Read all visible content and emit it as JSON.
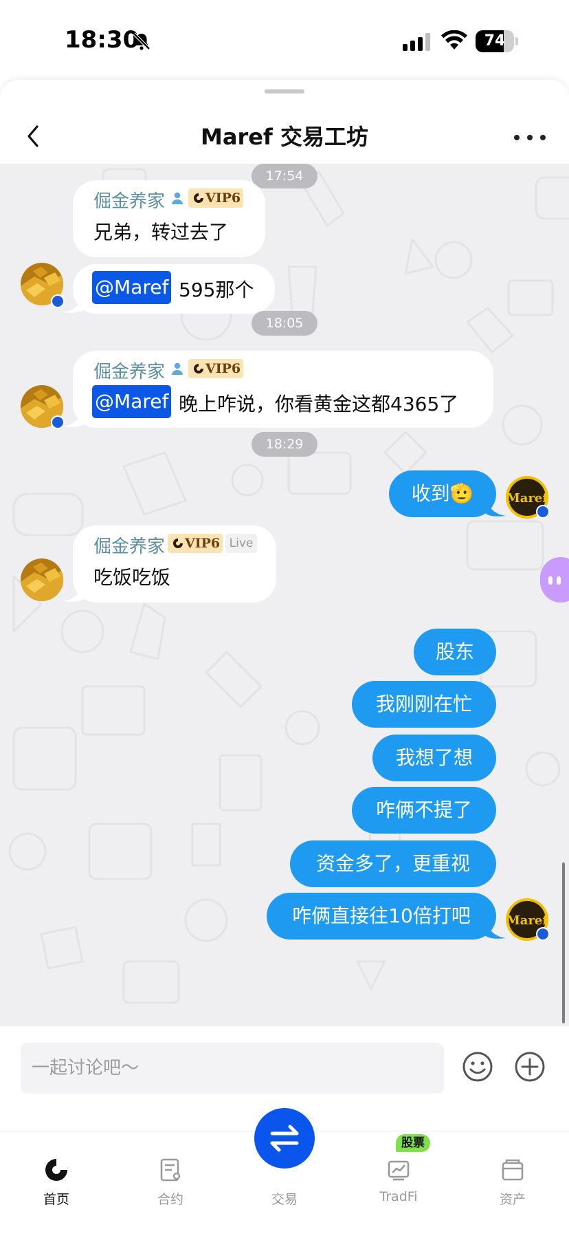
{
  "status_bar": {
    "time": "18:30",
    "battery": "74",
    "battery_level": 0.74
  },
  "header": {
    "title": "Maref 交易工坊"
  },
  "messages": {
    "time_1": "17:54",
    "time_2": "18:05",
    "time_3": "18:29",
    "group1": {
      "sender": "倔金养家",
      "vip": "VIP6",
      "text1": "兄弟，转过去了",
      "mention": "@Maref",
      "text2": "595那个"
    },
    "group2": {
      "sender": "倔金养家",
      "vip": "VIP6",
      "mention": "@Maref",
      "text": "晚上咋说，你看黄金这都4365了"
    },
    "out1": "收到🫡",
    "group3": {
      "sender": "倔金养家",
      "vip": "VIP6",
      "live": "Live",
      "text": "吃饭吃饭"
    },
    "outgoing": [
      "股东",
      "我刚刚在忙",
      "我想了想",
      "咋俩不提了",
      "资金多了，更重视",
      "咋俩直接往10倍打吧"
    ]
  },
  "input": {
    "placeholder": "一起讨论吧～"
  },
  "nav": {
    "home": "首页",
    "contract": "合约",
    "trade": "交易",
    "tradfi": "TradFi",
    "tradfi_badge": "股票",
    "assets": "资产"
  },
  "colors": {
    "outgoing_bubble": "#1e9bf0",
    "mention": "#0b57e6",
    "brand_blue": "#0a56ec",
    "vip_badge": "#fbe3b4",
    "sender_name": "#5a8fa3"
  },
  "icons": [
    "bell-slash-icon",
    "signal-icon",
    "wifi-icon",
    "battery-icon",
    "back-chevron-icon",
    "more-dots-icon",
    "emoji-icon",
    "plus-circle-icon",
    "home-logo-icon",
    "contract-icon",
    "swap-arrows-icon",
    "tradfi-chart-icon",
    "wallet-icon"
  ]
}
